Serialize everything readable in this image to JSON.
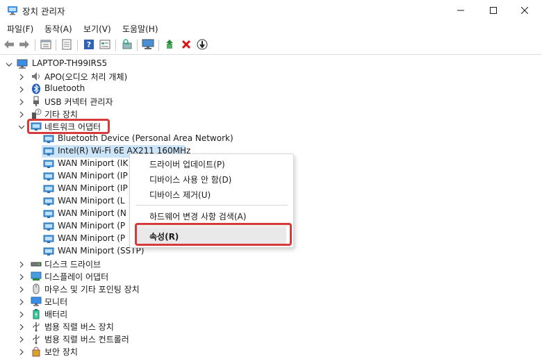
{
  "window": {
    "title": "장치 관리자",
    "accent": "#0067c0",
    "highlight_color": "#d63a3a",
    "selection_color": "#cce4f7"
  },
  "window_controls": [
    "minimize-icon",
    "maximize-icon",
    "close-icon"
  ],
  "menu": [
    "파일(F)",
    "동작(A)",
    "보기(V)",
    "도움말(H)"
  ],
  "toolbar_icons": [
    "back-arrow-icon",
    "forward-arrow-icon",
    "properties-icon",
    "document-icon",
    "help-icon",
    "view-icon",
    "scan-hardware-icon",
    "monitor-icon",
    "update-driver-icon",
    "uninstall-x-icon",
    "disable-device-icon"
  ],
  "tree": {
    "root": "LAPTOP-TH99IRS5",
    "categories_before": [
      {
        "label": "APO(오디오 처리 개체)",
        "icon": "speaker-icon"
      },
      {
        "label": "Bluetooth",
        "icon": "bluetooth-icon"
      },
      {
        "label": "USB 커넥터 관리자",
        "icon": "usb-icon"
      },
      {
        "label": "기타 장치",
        "icon": "unknown-device-icon"
      }
    ],
    "network_category": "네트워크 어댑터",
    "network_children": [
      "Bluetooth Device (Personal Area Network)",
      "Intel(R) Wi-Fi 6E AX211 160MHz",
      "WAN Miniport (IK",
      "WAN Miniport (IP",
      "WAN Miniport (IP",
      "WAN Miniport (L",
      "WAN Miniport (N",
      "WAN Miniport (P",
      "WAN Miniport (P",
      "WAN Miniport (SSTP)"
    ],
    "categories_after": [
      {
        "label": "디스크 드라이브",
        "icon": "disk-drive-icon"
      },
      {
        "label": "디스플레이 어댑터",
        "icon": "display-adapter-icon"
      },
      {
        "label": "마우스 및 기타 포인팅 장치",
        "icon": "mouse-icon"
      },
      {
        "label": "모니터",
        "icon": "monitor-icon"
      },
      {
        "label": "배터리",
        "icon": "battery-icon"
      },
      {
        "label": "범용 직렬 버스 장치",
        "icon": "usb-icon"
      },
      {
        "label": "범용 직렬 버스 컨트롤러",
        "icon": "usb-icon"
      },
      {
        "label": "보안 장치",
        "icon": "security-icon"
      }
    ]
  },
  "context_menu": {
    "items": [
      "드라이버 업데이트(P)",
      "디바이스 사용 안 함(D)",
      "디바이스 제거(U)",
      "하드웨어 변경 사항 검색(A)",
      "속성(R)"
    ]
  }
}
